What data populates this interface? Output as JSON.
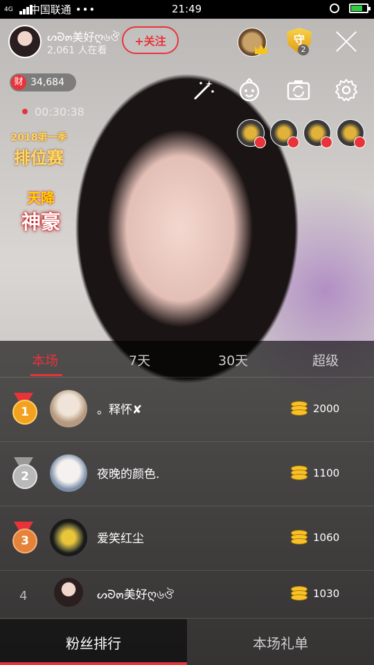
{
  "status_bar": {
    "network": "4G",
    "carrier": "中国联通",
    "dots": "•••",
    "time": "21:49"
  },
  "host": {
    "name": "ᔕᘐ๓美好ღ৬ঔ",
    "viewers": "2,061 人在看",
    "follow_label": "+关注",
    "guard_count": "2",
    "guard_glyph": "守"
  },
  "wealth": {
    "icon_label": "财",
    "value": "34,684"
  },
  "live_timer": "00:30:38",
  "badges": {
    "season": "2018第一季",
    "season_title": "排位赛",
    "god_line1": "天降",
    "god_line2": "神豪"
  },
  "tabs": [
    {
      "label": "本场",
      "active": true
    },
    {
      "label": "7天",
      "active": false
    },
    {
      "label": "30天",
      "active": false
    },
    {
      "label": "超级",
      "active": false
    }
  ],
  "ranking": [
    {
      "rank": "1",
      "name": "。释怀✘",
      "score": "2000",
      "medal": "gold"
    },
    {
      "rank": "2",
      "name": "夜晚的颜色.",
      "score": "1100",
      "medal": "silver"
    },
    {
      "rank": "3",
      "name": "爱笑红尘",
      "score": "1060",
      "medal": "bronze"
    },
    {
      "rank": "4",
      "name": "ᔕᘐ๓美好ღ৬ঔ",
      "score": "1030",
      "medal": "none"
    }
  ],
  "bottom_tabs": [
    {
      "label": "粉丝排行",
      "active": true
    },
    {
      "label": "本场礼单",
      "active": false
    }
  ],
  "colors": {
    "accent": "#e8333a",
    "gold": "#f3a21f",
    "silver": "#b9b9b9",
    "bronze": "#e6833a"
  }
}
